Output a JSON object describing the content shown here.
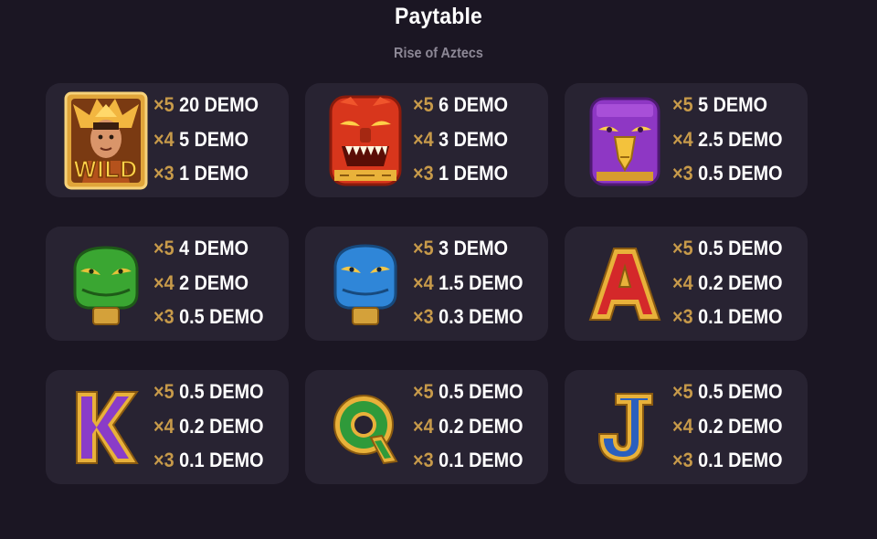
{
  "header": {
    "title": "Paytable",
    "subtitle": "Rise of Aztecs"
  },
  "symbols": [
    {
      "icon": "wild-warrior-icon",
      "label": "WILD",
      "pays": [
        {
          "mult": "×5",
          "value": "20 DEMO"
        },
        {
          "mult": "×4",
          "value": "5 DEMO"
        },
        {
          "mult": "×3",
          "value": "1 DEMO"
        }
      ]
    },
    {
      "icon": "red-jaguar-mask-icon",
      "pays": [
        {
          "mult": "×5",
          "value": "6 DEMO"
        },
        {
          "mult": "×4",
          "value": "3 DEMO"
        },
        {
          "mult": "×3",
          "value": "1 DEMO"
        }
      ]
    },
    {
      "icon": "purple-eagle-mask-icon",
      "pays": [
        {
          "mult": "×5",
          "value": "5 DEMO"
        },
        {
          "mult": "×4",
          "value": "2.5 DEMO"
        },
        {
          "mult": "×3",
          "value": "0.5 DEMO"
        }
      ]
    },
    {
      "icon": "green-serpent-mask-icon",
      "pays": [
        {
          "mult": "×5",
          "value": "4 DEMO"
        },
        {
          "mult": "×4",
          "value": "2 DEMO"
        },
        {
          "mult": "×3",
          "value": "0.5 DEMO"
        }
      ]
    },
    {
      "icon": "blue-serpent-mask-icon",
      "pays": [
        {
          "mult": "×5",
          "value": "3 DEMO"
        },
        {
          "mult": "×4",
          "value": "1.5 DEMO"
        },
        {
          "mult": "×3",
          "value": "0.3 DEMO"
        }
      ]
    },
    {
      "icon": "letter-a-icon",
      "pays": [
        {
          "mult": "×5",
          "value": "0.5 DEMO"
        },
        {
          "mult": "×4",
          "value": "0.2 DEMO"
        },
        {
          "mult": "×3",
          "value": "0.1 DEMO"
        }
      ]
    },
    {
      "icon": "letter-k-icon",
      "pays": [
        {
          "mult": "×5",
          "value": "0.5 DEMO"
        },
        {
          "mult": "×4",
          "value": "0.2 DEMO"
        },
        {
          "mult": "×3",
          "value": "0.1 DEMO"
        }
      ]
    },
    {
      "icon": "letter-q-icon",
      "pays": [
        {
          "mult": "×5",
          "value": "0.5 DEMO"
        },
        {
          "mult": "×4",
          "value": "0.2 DEMO"
        },
        {
          "mult": "×3",
          "value": "0.1 DEMO"
        }
      ]
    },
    {
      "icon": "letter-j-icon",
      "pays": [
        {
          "mult": "×5",
          "value": "0.5 DEMO"
        },
        {
          "mult": "×4",
          "value": "0.2 DEMO"
        },
        {
          "mult": "×3",
          "value": "0.1 DEMO"
        }
      ]
    }
  ],
  "colors": {
    "background": "#1b1623",
    "card": "#282332",
    "multiplier": "#c79a4a",
    "value": "#ffffff",
    "subtitle": "#8d8896"
  }
}
